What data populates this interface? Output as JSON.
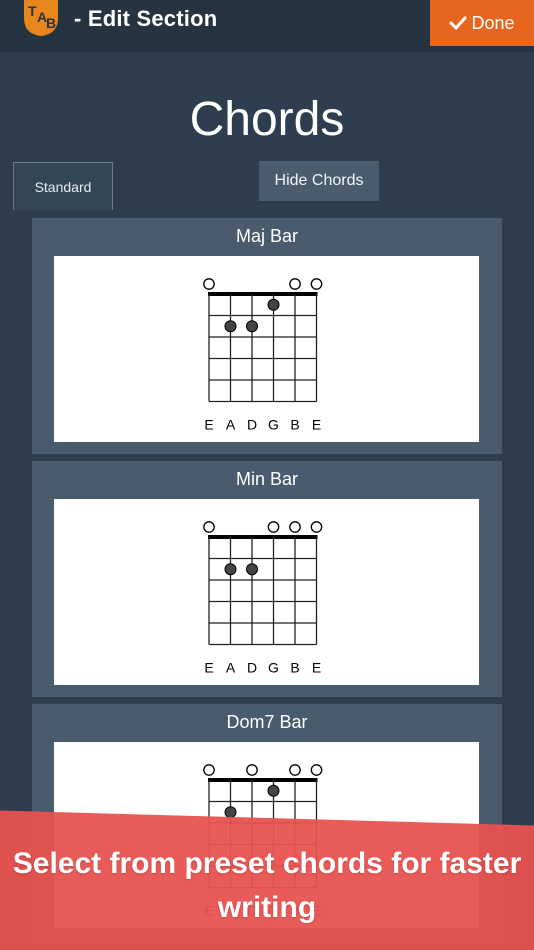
{
  "header": {
    "title": "-  Edit Section",
    "done_label": "Done",
    "logo_text": "TAB"
  },
  "page": {
    "title": "Chords",
    "tab_standard": "Standard",
    "hide_chords_label": "Hide Chords"
  },
  "chords": [
    {
      "name": "Maj Bar",
      "strings": [
        "E",
        "A",
        "D",
        "G",
        "B",
        "E"
      ],
      "open": [
        0,
        4,
        5
      ],
      "muted": [],
      "dots": [
        {
          "string": 3,
          "fret": 1
        },
        {
          "string": 1,
          "fret": 2
        },
        {
          "string": 2,
          "fret": 2
        }
      ]
    },
    {
      "name": "Min Bar",
      "strings": [
        "E",
        "A",
        "D",
        "G",
        "B",
        "E"
      ],
      "open": [
        0,
        3,
        4,
        5
      ],
      "muted": [],
      "dots": [
        {
          "string": 1,
          "fret": 2
        },
        {
          "string": 2,
          "fret": 2
        }
      ]
    },
    {
      "name": "Dom7 Bar",
      "strings": [
        "E",
        "A",
        "D",
        "G",
        "B",
        "E"
      ],
      "open": [
        0,
        2,
        4,
        5
      ],
      "muted": [],
      "dots": [
        {
          "string": 3,
          "fret": 1
        },
        {
          "string": 1,
          "fret": 2
        }
      ]
    }
  ],
  "banner": {
    "text": "Select from preset chords for faster writing"
  },
  "colors": {
    "accent": "#e8651e",
    "banner": "#e8524f",
    "background": "#2f3e4f",
    "card": "#4a5b6d"
  }
}
